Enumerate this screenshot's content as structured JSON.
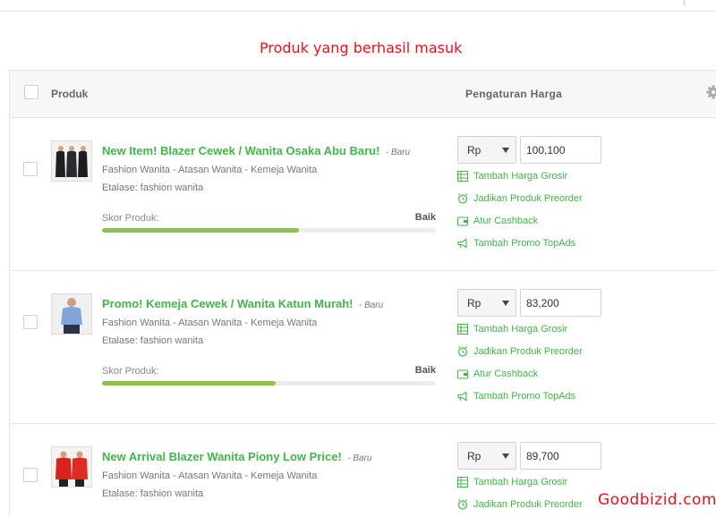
{
  "annotation": {
    "text": "Produk yang berhasil masuk"
  },
  "table": {
    "col_produk": "Produk",
    "col_harga": "Pengaturan Harga"
  },
  "skor_label": "Skor Produk:",
  "actions": {
    "grosir": "Tambah Harga Grosir",
    "preorder": "Jadikan Produk Preorder",
    "cashback": "Atur Cashback",
    "topads": "Tambah Promo TopAds"
  },
  "products": [
    {
      "title": "New Item! Blazer Cewek / Wanita Osaka Abu Baru!",
      "badge": "- Baru",
      "category": "Fashion Wanita - Atasan Wanita - Kemeja Wanita",
      "etalase": "Etalase:  fashion wanita",
      "skor_value": "Baik",
      "skor_fraction": 0.59,
      "currency": "Rp",
      "price": "100,100"
    },
    {
      "title": "Promo! Kemeja Cewek / Wanita Katun Murah!",
      "badge": "- Baru",
      "category": "Fashion Wanita - Atasan Wanita - Kemeja Wanita",
      "etalase": "Etalase:  fashion wanita",
      "skor_value": "Baik",
      "skor_fraction": 0.52,
      "currency": "Rp",
      "price": "83,200"
    },
    {
      "title": "New Arrival Blazer Wanita Piony Low Price!",
      "badge": "- Baru",
      "category": "Fashion Wanita - Atasan Wanita - Kemeja Wanita",
      "etalase": "Etalase:  fashion wanita",
      "currency": "Rp",
      "price": "89,700"
    }
  ],
  "watermark": "Goodbizid.com",
  "colors": {
    "accent_green": "#42b549",
    "annotation_red": "#e8121e",
    "score_bar": "#8bc34a"
  }
}
